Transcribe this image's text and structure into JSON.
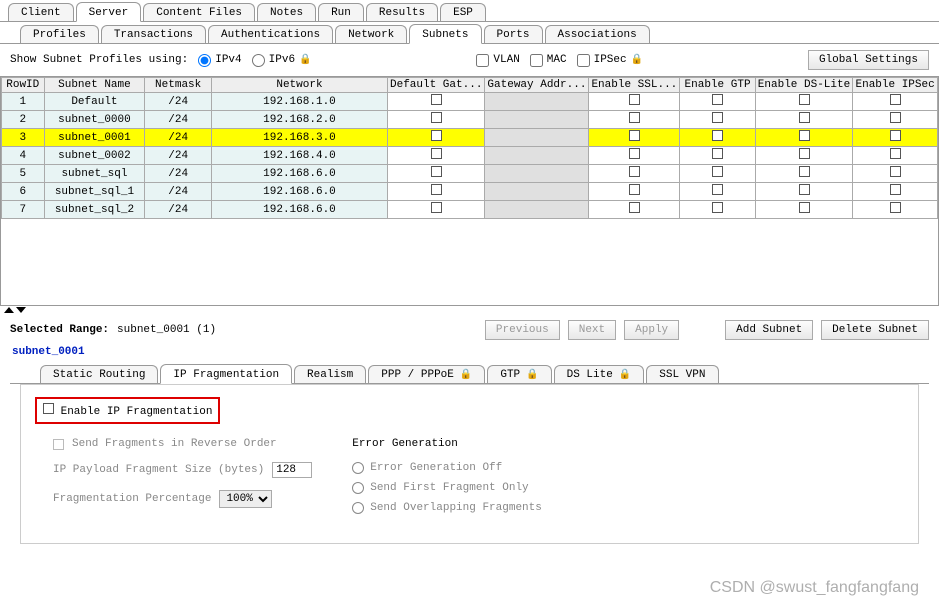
{
  "topTabs": [
    "Client",
    "Server",
    "Content Files",
    "Notes",
    "Run",
    "Results",
    "ESP"
  ],
  "topActive": "Server",
  "subTabs": [
    "Profiles",
    "Transactions",
    "Authentications",
    "Network",
    "Subnets",
    "Ports",
    "Associations"
  ],
  "subActive": "Subnets",
  "toolbar": {
    "showLabel": "Show Subnet Profiles using:",
    "ipv4": "IPv4",
    "ipv6": "IPv6",
    "vlan": "VLAN",
    "mac": "MAC",
    "ipsec": "IPSec",
    "globalSettings": "Global Settings"
  },
  "columns": [
    "RowID",
    "Subnet Name",
    "Netmask",
    "Network",
    "Default Gat...",
    "Gateway Addr...",
    "Enable SSL...",
    "Enable GTP",
    "Enable DS-Lite",
    "Enable IPSec"
  ],
  "rows": [
    {
      "id": "1",
      "name": "Default",
      "mask": "/24",
      "net": "192.168.1.0",
      "hl": false
    },
    {
      "id": "2",
      "name": "subnet_0000",
      "mask": "/24",
      "net": "192.168.2.0",
      "hl": false
    },
    {
      "id": "3",
      "name": "subnet_0001",
      "mask": "/24",
      "net": "192.168.3.0",
      "hl": true
    },
    {
      "id": "4",
      "name": "subnet_0002",
      "mask": "/24",
      "net": "192.168.4.0",
      "hl": false
    },
    {
      "id": "5",
      "name": "subnet_sql",
      "mask": "/24",
      "net": "192.168.6.0",
      "hl": false
    },
    {
      "id": "6",
      "name": "subnet_sql_1",
      "mask": "/24",
      "net": "192.168.6.0",
      "hl": false
    },
    {
      "id": "7",
      "name": "subnet_sql_2",
      "mask": "/24",
      "net": "192.168.6.0",
      "hl": false
    }
  ],
  "selected": {
    "label": "Selected Range:",
    "value": "subnet_0001 (1)",
    "prev": "Previous",
    "next": "Next",
    "apply": "Apply",
    "add": "Add Subnet",
    "del": "Delete Subnet",
    "name": "subnet_0001"
  },
  "detailTabs": [
    "Static Routing",
    "IP Fragmentation",
    "Realism",
    "PPP / PPPoE",
    "GTP",
    "DS Lite",
    "SSL VPN"
  ],
  "detailActive": "IP Fragmentation",
  "frag": {
    "enable": "Enable IP Fragmentation",
    "reverse": "Send Fragments in Reverse Order",
    "payloadLabel": "IP Payload Fragment Size (bytes)",
    "payloadVal": "128",
    "pctLabel": "Fragmentation Percentage",
    "pctVal": "100%",
    "errTitle": "Error Generation",
    "errOff": "Error Generation Off",
    "errFirst": "Send First Fragment Only",
    "errOverlap": "Send Overlapping Fragments"
  },
  "watermark": "CSDN @swust_fangfangfang"
}
